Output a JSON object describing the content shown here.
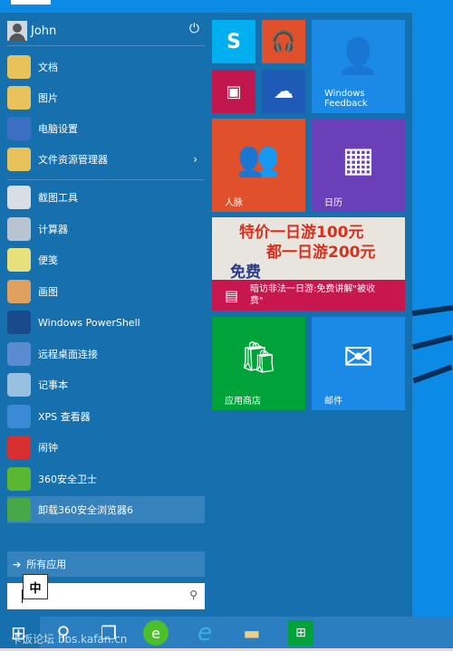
{
  "user": {
    "name": "John"
  },
  "places": [
    {
      "label": "文档",
      "color": "#e8c25a"
    },
    {
      "label": "图片",
      "color": "#e8c25a"
    },
    {
      "label": "电脑设置",
      "color": "#3a6fc4"
    },
    {
      "label": "文件资源管理器",
      "color": "#e8c25a"
    }
  ],
  "apps": [
    {
      "label": "截图工具",
      "color": "#d9dde4"
    },
    {
      "label": "计算器",
      "color": "#b8c4d0"
    },
    {
      "label": "便笺",
      "color": "#e8e07a"
    },
    {
      "label": "画图",
      "color": "#e0a060"
    },
    {
      "label": "Windows PowerShell",
      "color": "#1a4a8a"
    },
    {
      "label": "远程桌面连接",
      "color": "#5a8ad0"
    },
    {
      "label": "记事本",
      "color": "#9ac0e0"
    },
    {
      "label": "XPS 查看器",
      "color": "#3a8ad8"
    },
    {
      "label": "闹钟",
      "color": "#d83030"
    },
    {
      "label": "360安全卫士",
      "color": "#5ab830"
    },
    {
      "label": "卸载360安全浏览器6",
      "color": "#48a848"
    }
  ],
  "all_apps": "所有应用",
  "ime": "中",
  "tiles": {
    "feedback": "Windows Feedback",
    "people": "人脉",
    "calendar": "日历",
    "news": "暗访非法一日游:免费讲解\"被收费\"",
    "news_bg": [
      "特价一日游100元",
      "都一日游200元",
      "免费"
    ],
    "store": "应用商店",
    "mail": "邮件"
  },
  "colors": {
    "menu": "#1670ae",
    "skype": "#00aff0",
    "music": "#e0512b",
    "video": "#c1174e",
    "onedrive": "#1e5bb7",
    "feedback": "#1a8ae6",
    "people": "#e0512b",
    "calendar": "#6b3fb8",
    "news": "#c8164f",
    "store": "#00a33a",
    "mail": "#1a8ae6"
  },
  "watermark": "卡饭论坛 bbs.kafan.cn"
}
